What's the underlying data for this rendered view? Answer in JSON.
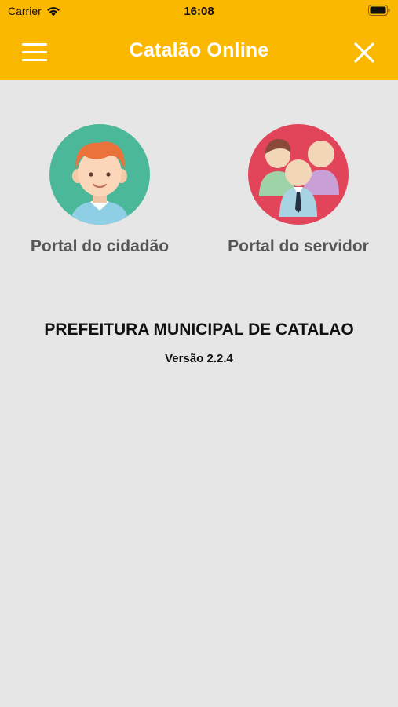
{
  "status_bar": {
    "carrier": "Carrier",
    "time": "16:08",
    "icons": [
      "wifi-icon",
      "battery-icon"
    ]
  },
  "navbar": {
    "title": "Catalão Online",
    "left_icon": "menu-icon",
    "right_icon": "close-icon",
    "background_color": "#fbb800"
  },
  "portals": [
    {
      "label": "Portal do cidadão",
      "icon": "citizen-avatar-icon",
      "circle_color": "#4cb89a"
    },
    {
      "label": "Portal do servidor",
      "icon": "staff-group-icon",
      "circle_color": "#e2445a"
    }
  ],
  "footer": {
    "organization": "PREFEITURA MUNICIPAL DE CATALAO",
    "version": "Versão 2.2.4"
  }
}
